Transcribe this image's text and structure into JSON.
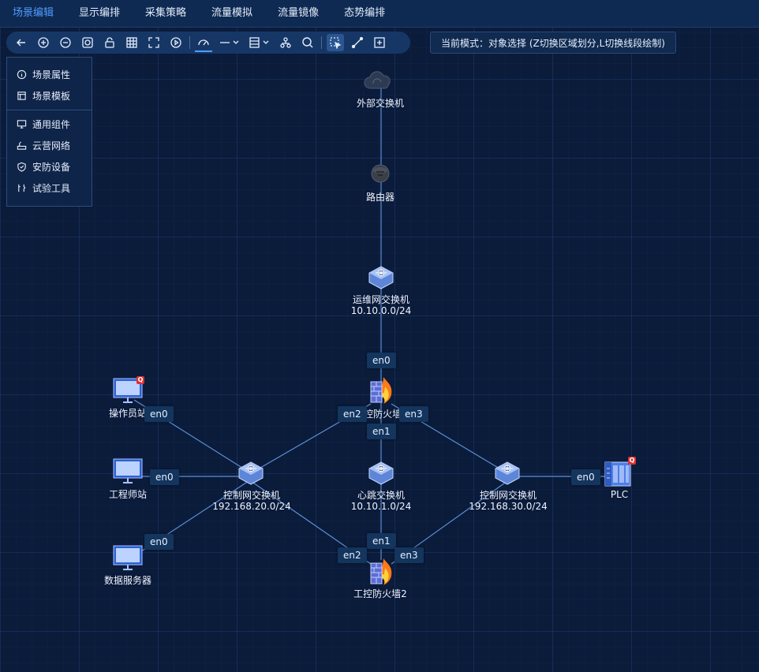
{
  "menu": {
    "items": [
      {
        "label": "场景编辑",
        "active": true
      },
      {
        "label": "显示编排"
      },
      {
        "label": "采集策略"
      },
      {
        "label": "流量模拟"
      },
      {
        "label": "流量镜像"
      },
      {
        "label": "态势编排"
      }
    ]
  },
  "toolbar": {
    "icons": [
      "back-icon",
      "zoom-in-icon",
      "zoom-out-icon",
      "fit-view-icon",
      "lock-icon",
      "grid-icon",
      "fullscreen-icon",
      "play-icon",
      "gauge-icon",
      "line-style-icon",
      "layout-icon",
      "tree-icon",
      "search-icon",
      "select-box-icon",
      "draw-line-icon",
      "add-node-icon"
    ]
  },
  "mode": {
    "text": "当前模式：对象选择 (Z切换区域划分,L切换线段绘制)"
  },
  "panel": {
    "scene_props": "场景属性",
    "scene_template": "场景模板",
    "common": "通用组件",
    "cloud_network": "云营网络",
    "security": "安防设备",
    "test_tools": "试验工具"
  },
  "nodes": {
    "external_switch": {
      "name": "外部交换机"
    },
    "router": {
      "name": "路由器"
    },
    "ops_switch": {
      "name": "运维网交换机",
      "subnet": "10.10.0.0/24"
    },
    "firewall1": {
      "name": "工控防火墙1"
    },
    "heartbeat_switch": {
      "name": "心跳交换机",
      "subnet": "10.10.1.0/24"
    },
    "ctrl_switch_left": {
      "name": "控制网交换机",
      "subnet": "192.168.20.0/24"
    },
    "ctrl_switch_right": {
      "name": "控制网交换机",
      "subnet": "192.168.30.0/24"
    },
    "operator_station": {
      "name": "操作员站"
    },
    "engineer_station": {
      "name": "工程师站"
    },
    "data_server": {
      "name": "数据服务器"
    },
    "plc": {
      "name": "PLC"
    },
    "firewall2": {
      "name": "工控防火墙2"
    }
  },
  "ports": {
    "en0": "en0",
    "en1": "en1",
    "en2": "en2",
    "en3": "en3"
  },
  "badge": "Q",
  "colors": {
    "accent": "#4f9bff",
    "link": "#5b8fd6",
    "badge": "#e03030"
  }
}
